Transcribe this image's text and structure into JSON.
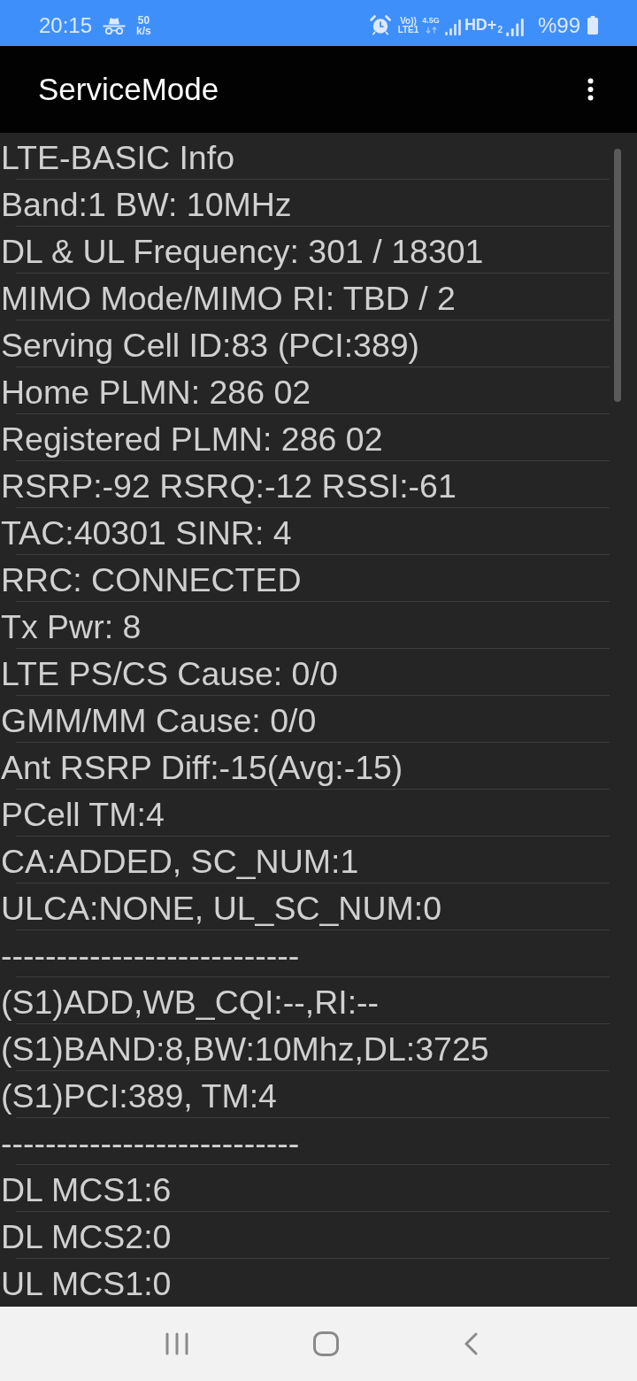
{
  "status_bar": {
    "time": "20:15",
    "speed_value": "50",
    "speed_unit": "k/s",
    "volte_top": "Vo))",
    "volte_bottom": "LTE1",
    "network_type": "4.5G",
    "hd_label": "HD+",
    "sim_number": "2",
    "battery": "%99"
  },
  "app_bar": {
    "title": "ServiceMode"
  },
  "lines": [
    "LTE-BASIC Info",
    "Band:1 BW: 10MHz",
    "DL & UL Frequency: 301 / 18301",
    "MIMO Mode/MIMO RI: TBD / 2",
    "Serving Cell ID:83 (PCI:389)",
    "Home PLMN: 286 02",
    "Registered PLMN: 286 02",
    "RSRP:-92 RSRQ:-12 RSSI:-61",
    "TAC:40301 SINR: 4",
    "RRC: CONNECTED",
    "Tx Pwr: 8",
    "LTE PS/CS Cause: 0/0",
    "GMM/MM Cause: 0/0",
    "Ant RSRP Diff:-15(Avg:-15)",
    "PCell TM:4",
    "CA:ADDED, SC_NUM:1",
    "ULCA:NONE, UL_SC_NUM:0",
    "---------------------------",
    "(S1)ADD,WB_CQI:--,RI:--",
    "(S1)BAND:8,BW:10Mhz,DL:3725",
    "(S1)PCI:389, TM:4",
    "---------------------------",
    "DL MCS1:6",
    "DL MCS2:0",
    "UL MCS1:0"
  ]
}
